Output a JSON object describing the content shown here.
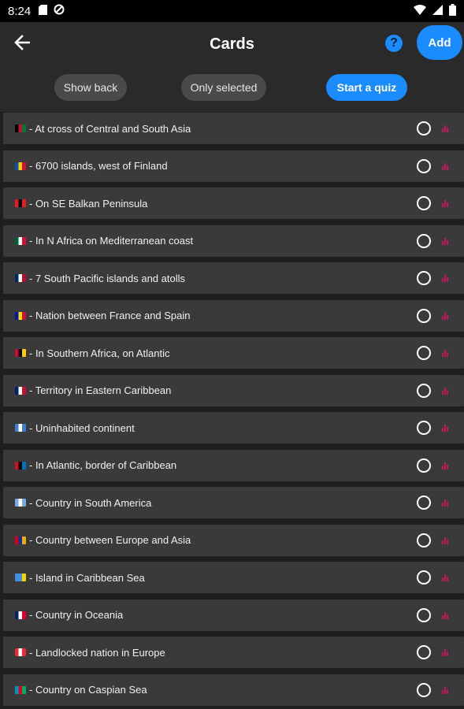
{
  "status_bar": {
    "time": "8:24"
  },
  "appbar": {
    "title": "Cards",
    "help_label": "?",
    "add_label": "Add"
  },
  "toolbar": {
    "show_back": "Show back",
    "only_selected": "Only selected",
    "start_quiz": "Start a quiz"
  },
  "colors": {
    "accent": "#1a8cff",
    "stats": "#c2185b",
    "row_bg": "#3a3a3a"
  },
  "cards": [
    {
      "text": "- At cross of Central and South Asia",
      "flag_colors": [
        "#000000",
        "#c8102e",
        "#007a36"
      ]
    },
    {
      "text": "- 6700 islands, west of Finland",
      "flag_colors": [
        "#0053a5",
        "#ffce00",
        "#d21034"
      ]
    },
    {
      "text": "- On SE Balkan Peninsula",
      "flag_colors": [
        "#e41e20",
        "#000000",
        "#e41e20"
      ]
    },
    {
      "text": "- In N Africa on Mediterranean coast",
      "flag_colors": [
        "#006233",
        "#ffffff",
        "#d21034"
      ]
    },
    {
      "text": "- 7 South Pacific islands and atolls",
      "flag_colors": [
        "#002868",
        "#ffffff",
        "#bf0a30"
      ]
    },
    {
      "text": "- Nation between France and Spain",
      "flag_colors": [
        "#0018a8",
        "#fedf00",
        "#d0103a"
      ]
    },
    {
      "text": "- In Southern Africa, on Atlantic",
      "flag_colors": [
        "#cc092f",
        "#000000",
        "#ffcb00"
      ]
    },
    {
      "text": "- Territory in Eastern Caribbean",
      "flag_colors": [
        "#012169",
        "#ffffff",
        "#c8102e"
      ]
    },
    {
      "text": "- Uninhabited continent",
      "flag_colors": [
        "#3a7dce",
        "#ffffff",
        "#3a7dce"
      ]
    },
    {
      "text": "- In Atlantic, border of Caribbean",
      "flag_colors": [
        "#ce1126",
        "#000000",
        "#0072c6"
      ]
    },
    {
      "text": "- Country in South America",
      "flag_colors": [
        "#74acdf",
        "#ffffff",
        "#74acdf"
      ]
    },
    {
      "text": "- Country between Europe and Asia",
      "flag_colors": [
        "#d90012",
        "#0033a0",
        "#f2a800"
      ]
    },
    {
      "text": "- Island in Caribbean Sea",
      "flag_colors": [
        "#418fde",
        "#418fde",
        "#ffd100"
      ]
    },
    {
      "text": "- Country in Oceania",
      "flag_colors": [
        "#012169",
        "#ffffff",
        "#e4002b"
      ]
    },
    {
      "text": "- Landlocked nation in Europe",
      "flag_colors": [
        "#ed2939",
        "#ffffff",
        "#ed2939"
      ]
    },
    {
      "text": "- Country on Caspian Sea",
      "flag_colors": [
        "#0092bc",
        "#e4002b",
        "#00af66"
      ]
    }
  ]
}
